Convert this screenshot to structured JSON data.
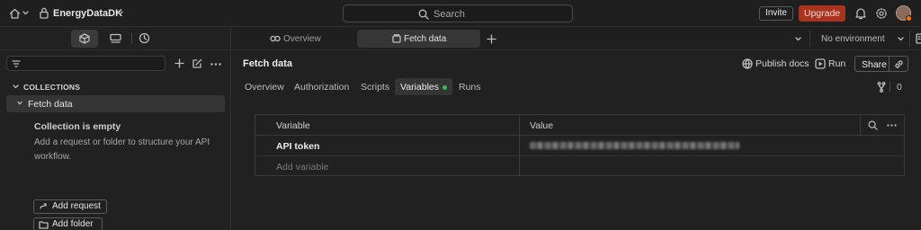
{
  "topbar": {
    "workspace_name": "EnergyDataDK",
    "search_placeholder": "Search",
    "invite_label": "Invite",
    "upgrade_label": "Upgrade"
  },
  "sidebar": {
    "section_title": "COLLECTIONS",
    "collection_name": "Fetch data",
    "empty_title": "Collection is empty",
    "empty_description": "Add a request or folder to structure your API workflow.",
    "add_request_label": "Add request",
    "add_folder_label": "Add folder"
  },
  "tabs": [
    {
      "label": "Overview"
    },
    {
      "label": "Fetch data"
    }
  ],
  "environment": {
    "selected": "No environment"
  },
  "request": {
    "title": "Fetch data",
    "publish_docs_label": "Publish docs",
    "run_label": "Run",
    "share_label": "Share",
    "fork_count": "0"
  },
  "subtabs": [
    {
      "label": "Overview"
    },
    {
      "label": "Authorization"
    },
    {
      "label": "Scripts"
    },
    {
      "label": "Variables"
    },
    {
      "label": "Runs"
    }
  ],
  "variables_table": {
    "headers": {
      "variable": "Variable",
      "value": "Value"
    },
    "rows": [
      {
        "variable": "API token",
        "value_redacted": true
      }
    ],
    "add_placeholder": "Add variable"
  },
  "colors": {
    "upgrade": "#a8331f",
    "active_dot": "#3fb950",
    "background": "#212121"
  }
}
